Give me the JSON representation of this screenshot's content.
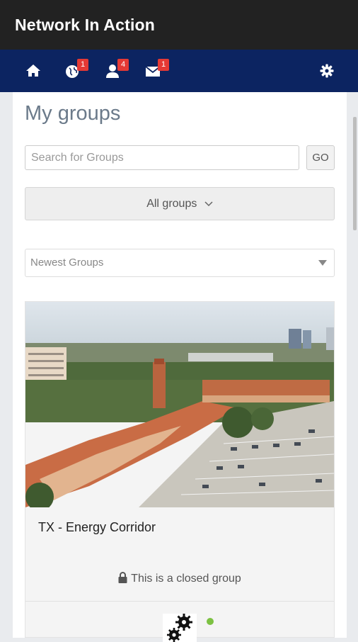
{
  "app": {
    "title": "Network In Action"
  },
  "nav": {
    "home_icon": "home-icon",
    "items": [
      {
        "icon": "globe-icon",
        "badge": "1"
      },
      {
        "icon": "user-icon",
        "badge": "4"
      },
      {
        "icon": "mail-icon",
        "badge": "1"
      }
    ],
    "settings_icon": "gear-icon"
  },
  "page": {
    "title": "My groups"
  },
  "search": {
    "placeholder": "Search for Groups",
    "button_label": "GO"
  },
  "filter": {
    "label": "All groups"
  },
  "sort": {
    "selected": "Newest Groups"
  },
  "groups": [
    {
      "name": "TX - Energy Corridor",
      "status": "This is a closed group",
      "online": true
    }
  ],
  "colors": {
    "appbar": "#222222",
    "navbar": "#0c2461",
    "badge": "#e53935",
    "online": "#7cc142"
  }
}
